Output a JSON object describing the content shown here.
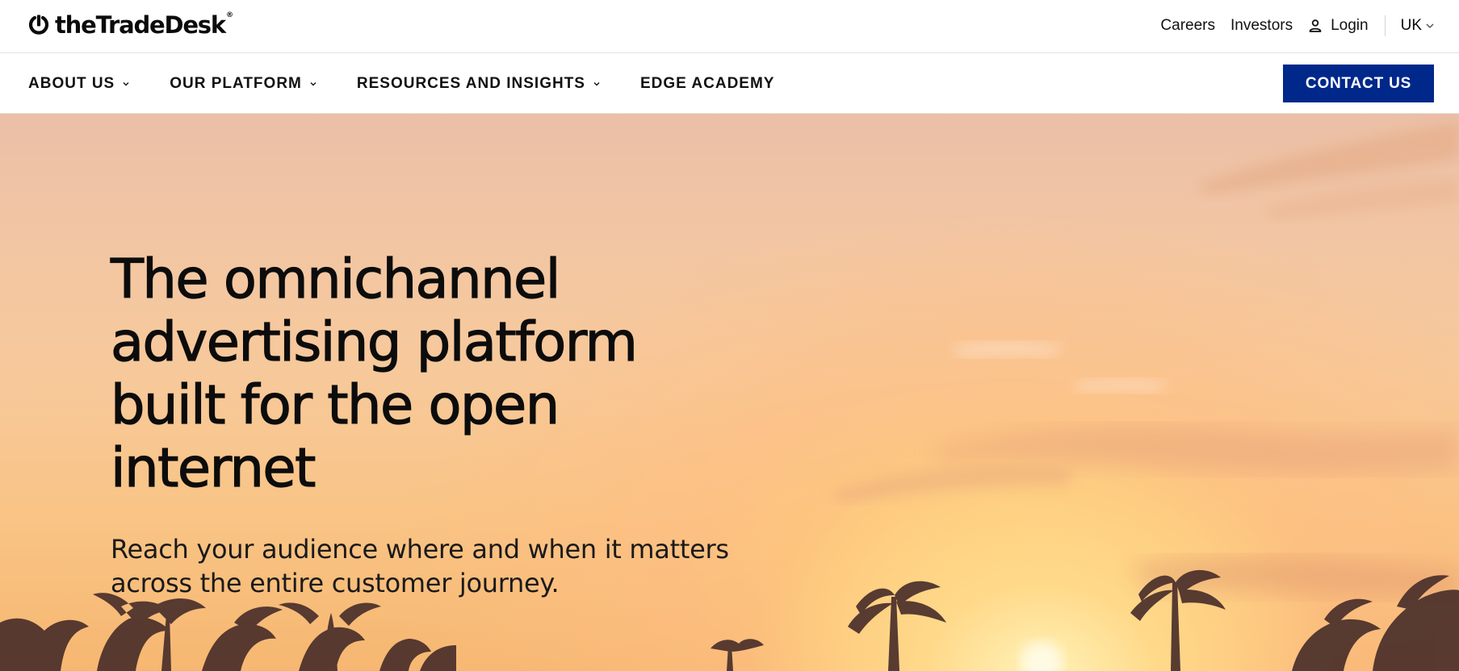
{
  "brand": {
    "name": "theTradeDesk",
    "registered_mark": "®"
  },
  "utility_nav": {
    "careers": "Careers",
    "investors": "Investors",
    "login": "Login",
    "region": "UK"
  },
  "main_nav": {
    "items": [
      {
        "label": "ABOUT US",
        "has_dropdown": true
      },
      {
        "label": "OUR PLATFORM",
        "has_dropdown": true
      },
      {
        "label": "RESOURCES AND INSIGHTS",
        "has_dropdown": true
      },
      {
        "label": "EDGE ACADEMY",
        "has_dropdown": false
      }
    ],
    "cta_label": "CONTACT US"
  },
  "hero": {
    "title": "The omnichannel advertising platform built for the open internet",
    "subtitle": "Reach your audience where and when it matters across the entire customer journey."
  },
  "colors": {
    "cta_background": "#00288a",
    "text": "#0b0b0b",
    "sky_top": "#ebbfa6",
    "sky_bottom": "#f6b771"
  },
  "icons": [
    "logo-mark-icon",
    "user-icon",
    "chevron-down-icon"
  ]
}
